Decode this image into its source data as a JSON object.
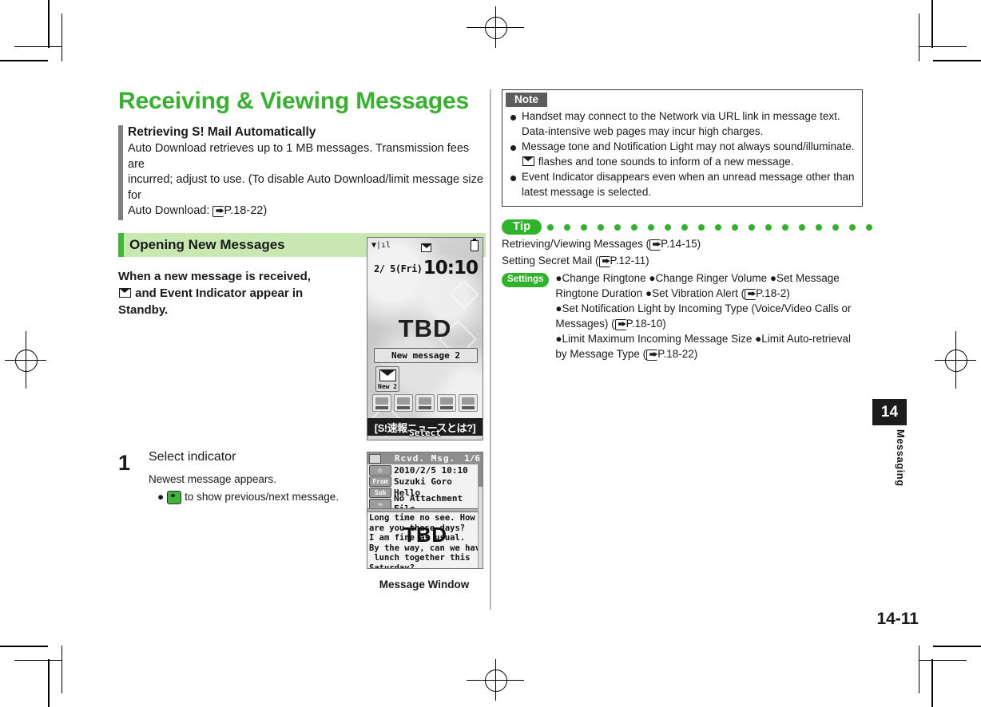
{
  "document": {
    "chapter_number": "14",
    "chapter_label": "Messaging",
    "page_number": "14-11"
  },
  "left": {
    "main_title": "Receiving & Viewing Messages",
    "subsection": {
      "title": "Retrieving S! Mail Automatically",
      "body_1": "Auto Download retrieves up to 1 MB messages. Transmission fees are",
      "body_2": "incurred; adjust to use. (To disable Auto Download/limit message size for",
      "body_3a": "Auto Download: ",
      "body_3b": "P.18-22)"
    },
    "green_bar_title": "Opening New Messages",
    "lead_1": "When a new message is received,",
    "lead_2a": "and Event Indicator appear in",
    "lead_3": "Standby.",
    "step": {
      "number": "1",
      "title": "Select indicator",
      "note": "Newest message appears.",
      "bullet": "to show previous/next message."
    },
    "caption": "Message Window"
  },
  "standby_screen": {
    "date": "2/ 5(Fri)",
    "time": "10:10",
    "wallpaper_text": "TBD",
    "new_message_banner": "New message 2",
    "event_indicator_label": "New 2",
    "ticker": "[S!速報ニュースとは?]",
    "softkey_center": "Select"
  },
  "message_window": {
    "title": "Rcvd. Msg.",
    "counter": "1/6",
    "rows": [
      {
        "tag": "time",
        "tag_text": "◴",
        "value": "2010/2/5 10:10"
      },
      {
        "tag": "from",
        "tag_text": "From",
        "value": "Suzuki Goro"
      },
      {
        "tag": "subject",
        "tag_text": "Sub",
        "value": "Hello"
      },
      {
        "tag": "attachment",
        "tag_text": "✉",
        "value": "No Attachment File"
      }
    ],
    "body": "Long time no see. How\nare you these days?\nI am fine as usual.\nBy the way, can we have\n lunch together this\nSaturday?",
    "body_watermark": "TBD"
  },
  "right": {
    "note": {
      "header": "Note",
      "items": [
        "Handset may connect to the Network via URL link in message text. Data-intensive web pages may incur high charges.",
        "Message tone and Notification Light may not always sound/illuminate.  flashes and tone sounds to inform of a new message.",
        "Event Indicator disappears even when an unread message other than latest message is selected."
      ],
      "item_2_part_a": "Message tone and Notification Light may not always sound/illuminate.",
      "item_2_part_b": "flashes and tone sounds to inform of a new message."
    },
    "tip": {
      "header": "Tip",
      "items": [
        "●Retrieving/Viewing Messages (",
        "●Setting Secret Mail ("
      ],
      "item_1_text": "Retrieving/Viewing Messages (",
      "item_1_ref": "P.14-15)",
      "item_2_text": "Setting Secret Mail (",
      "item_2_ref": "P.12-11)",
      "settings_badge": "Settings",
      "settings_line_1": "●Change Ringtone ●Change Ringer Volume ●Set Message",
      "settings_line_2a": "Ringtone Duration ●Set Vibration Alert (",
      "settings_line_2b": "P.18-2)",
      "settings_line_3a": "●Set Notification Light by Incoming Type (Voice/Video Calls or",
      "settings_line_3b": "Messages) (",
      "settings_line_3c": "P.18-10)",
      "settings_line_4": "●Limit Maximum Incoming Message Size ●Limit Auto-retrieval",
      "settings_line_5a": "by Message Type (",
      "settings_line_5b": "P.18-22)"
    }
  },
  "colors": {
    "brand_green": "#36b22e",
    "bar_green": "#43b735",
    "bar_green_light": "#c8e7b2",
    "badge_green": "#2fb32a",
    "note_header_gray": "#5d5d5d",
    "tab_black": "#1c1c1c"
  }
}
